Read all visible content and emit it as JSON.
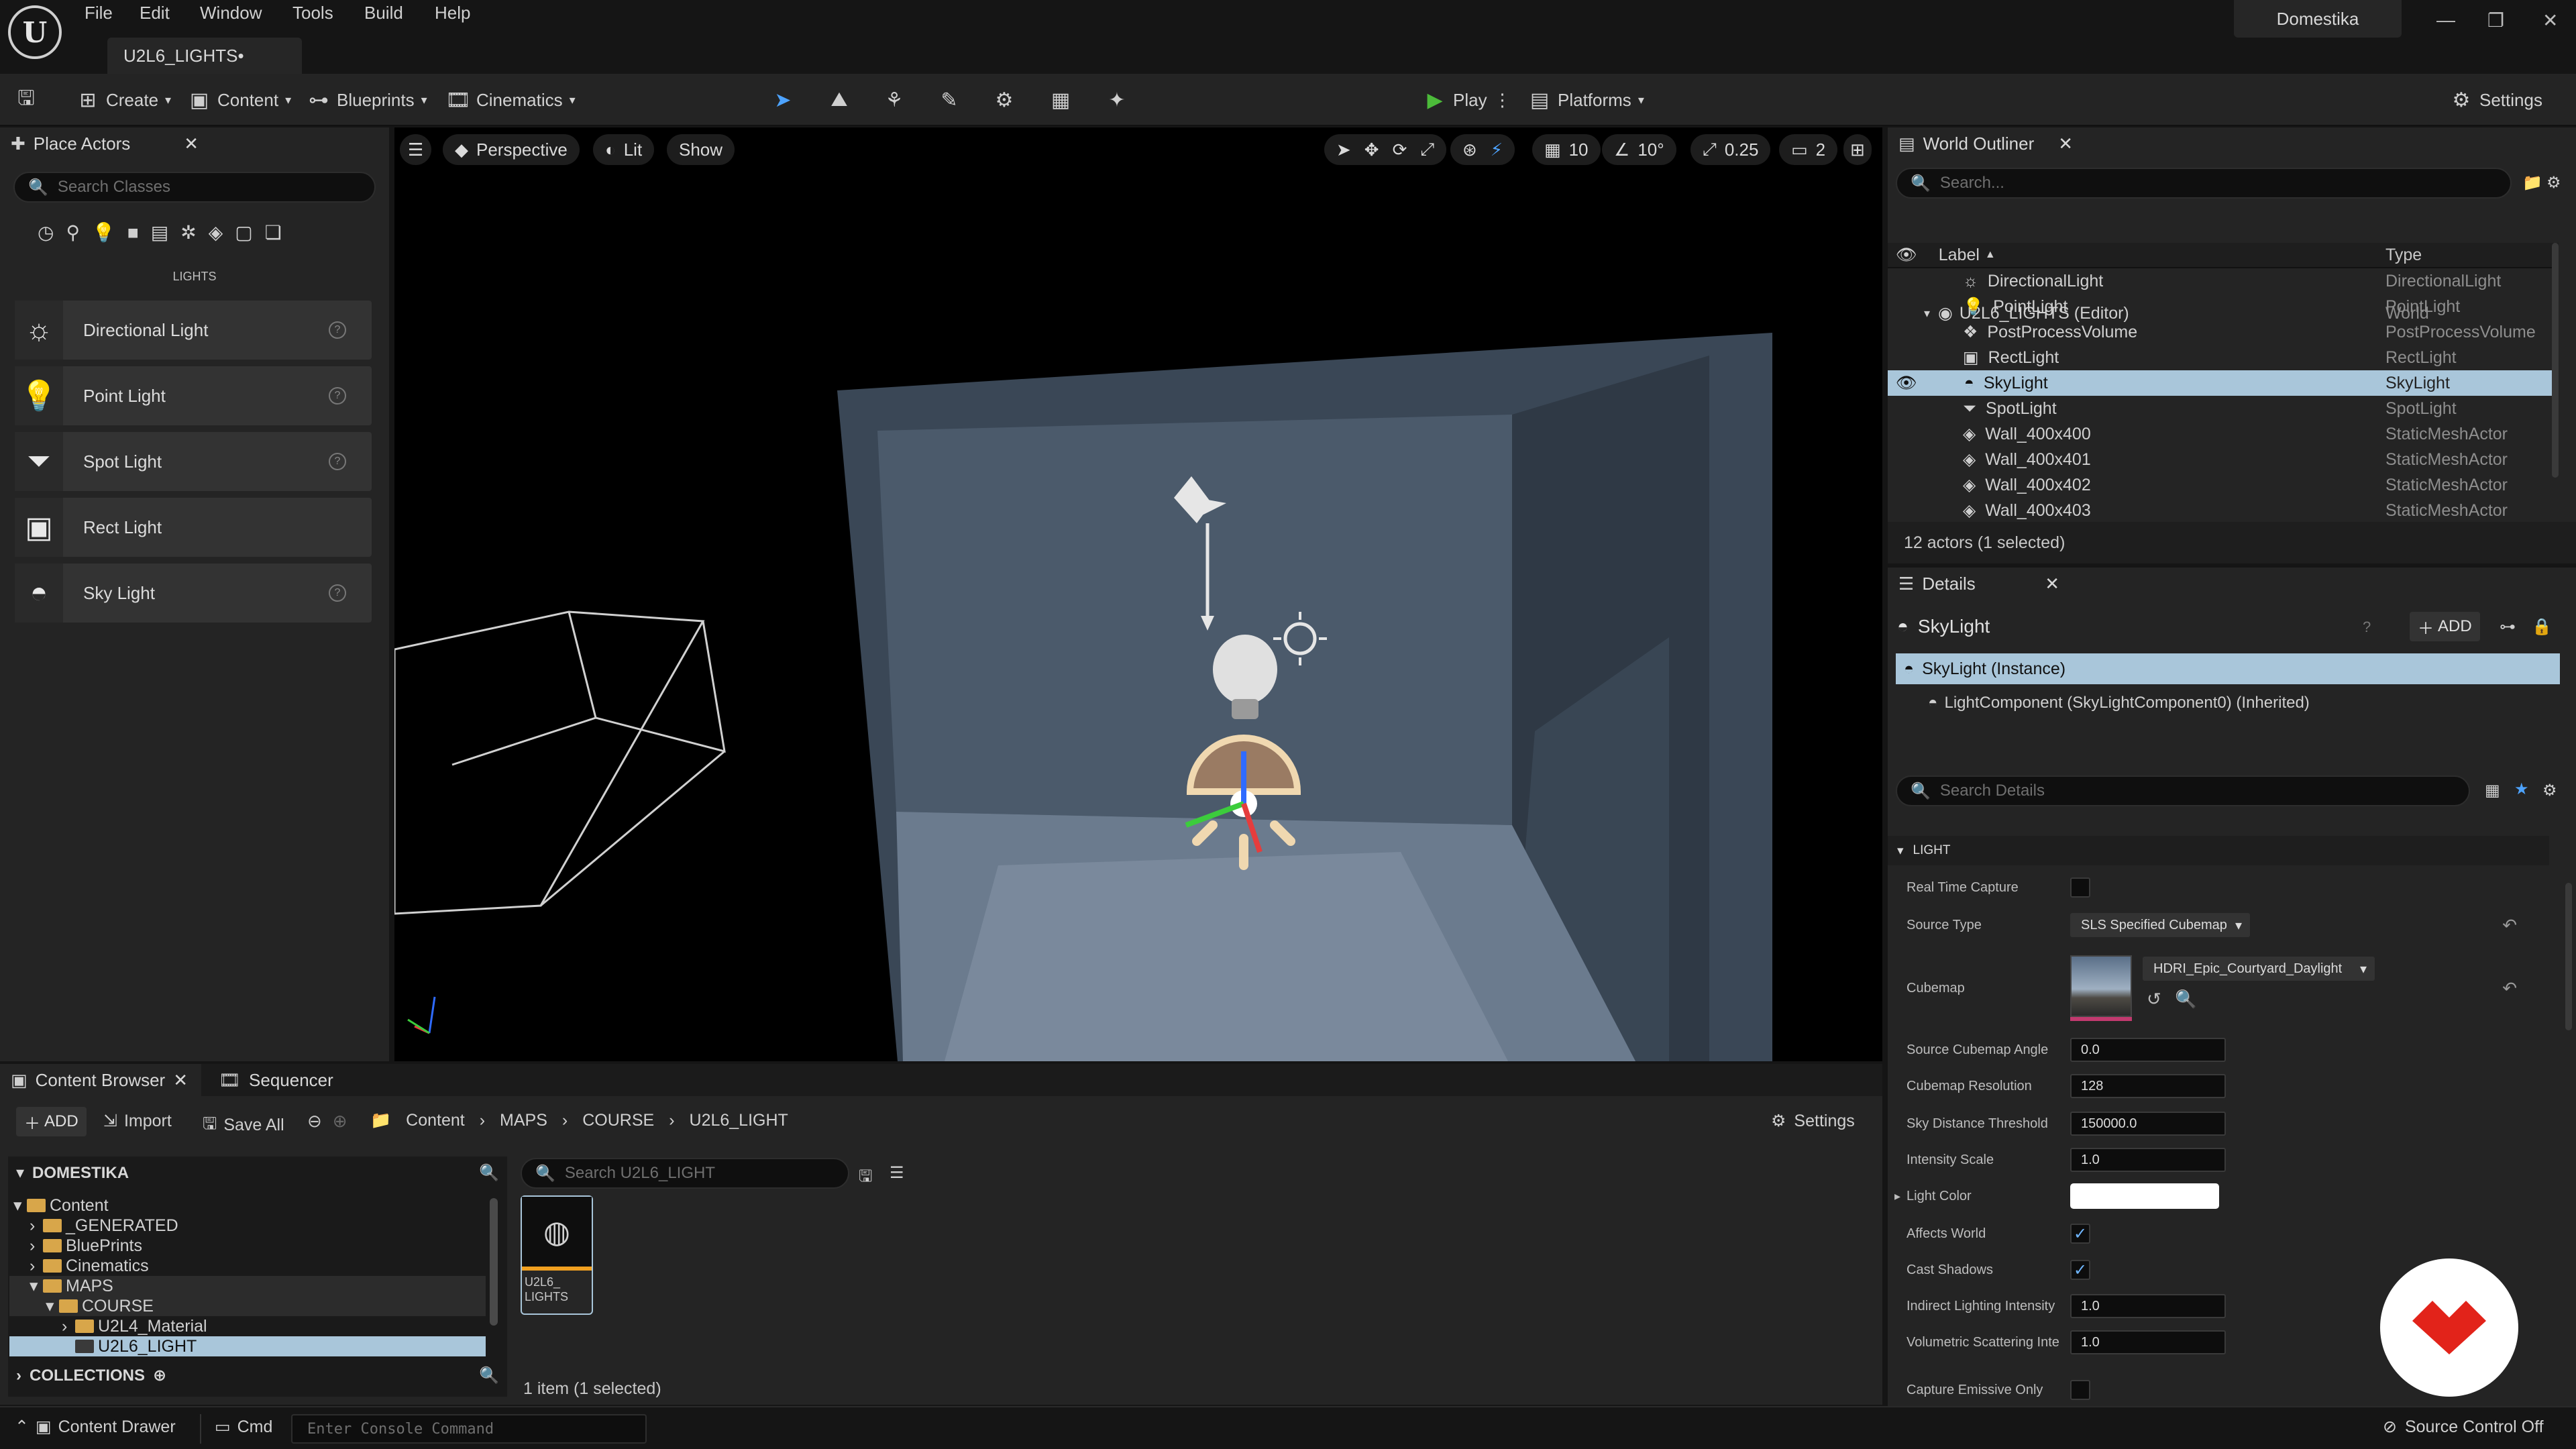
{
  "title_bar": {
    "menu": [
      "File",
      "Edit",
      "Window",
      "Tools",
      "Build",
      "Help"
    ],
    "map_tab": "U2L6_LIGHTS•",
    "brand": "Domestika"
  },
  "toolbar": {
    "create": "Create",
    "content": "Content",
    "blueprints": "Blueprints",
    "cinematics": "Cinematics",
    "play": "Play",
    "platforms": "Platforms",
    "settings": "Settings"
  },
  "place_actors": {
    "tab": "Place Actors",
    "search_placeholder": "Search Classes",
    "category": "LIGHTS",
    "items": [
      "Directional Light",
      "Point Light",
      "Spot Light",
      "Rect Light",
      "Sky Light"
    ]
  },
  "viewport": {
    "perspective": "Perspective",
    "lit": "Lit",
    "show": "Show",
    "grid_snap": "10",
    "rotation_snap": "10°",
    "scale_snap": "0.25",
    "camera_speed": "2"
  },
  "world_outliner": {
    "tab": "World Outliner",
    "search_placeholder": "Search...",
    "col_label": "Label",
    "col_type": "Type",
    "root": {
      "label": "U2L6_LIGHTS (Editor)",
      "type": "World"
    },
    "rows": [
      {
        "label": "DirectionalLight",
        "type": "DirectionalLight"
      },
      {
        "label": "PointLight",
        "type": "PointLight"
      },
      {
        "label": "PostProcessVolume",
        "type": "PostProcessVolume"
      },
      {
        "label": "RectLight",
        "type": "RectLight"
      },
      {
        "label": "SkyLight",
        "type": "SkyLight"
      },
      {
        "label": "SpotLight",
        "type": "SpotLight"
      },
      {
        "label": "Wall_400x400",
        "type": "StaticMeshActor"
      },
      {
        "label": "Wall_400x401",
        "type": "StaticMeshActor"
      },
      {
        "label": "Wall_400x402",
        "type": "StaticMeshActor"
      },
      {
        "label": "Wall_400x403",
        "type": "StaticMeshActor"
      }
    ],
    "footer": "12 actors (1 selected)"
  },
  "details": {
    "tab": "Details",
    "actor": "SkyLight",
    "add": "ADD",
    "instance": "SkyLight (Instance)",
    "component": "LightComponent (SkyLightComponent0) (Inherited)",
    "search_placeholder": "Search Details",
    "section": "LIGHT",
    "real_time_capture": "Real Time Capture",
    "source_type_label": "Source Type",
    "source_type_value": "SLS Specified Cubemap",
    "cubemap_label": "Cubemap",
    "cubemap_value": "HDRI_Epic_Courtyard_Daylight",
    "props": [
      {
        "label": "Source Cubemap Angle",
        "value": "0.0"
      },
      {
        "label": "Cubemap Resolution",
        "value": "128"
      },
      {
        "label": "Sky Distance Threshold",
        "value": "150000.0"
      },
      {
        "label": "Intensity Scale",
        "value": "1.0"
      }
    ],
    "light_color": "Light Color",
    "affects_world": "Affects World",
    "cast_shadows": "Cast Shadows",
    "props2": [
      {
        "label": "Indirect Lighting Intensity",
        "value": "1.0"
      },
      {
        "label": "Volumetric Scattering Inte",
        "value": "1.0"
      }
    ],
    "capture_emissive": "Capture Emissive Only"
  },
  "content_browser": {
    "tab": "Content Browser",
    "sequencer_tab": "Sequencer",
    "add": "ADD",
    "import": "Import",
    "save_all": "Save All",
    "breadcrumb": [
      "Content",
      "MAPS",
      "COURSE",
      "U2L6_LIGHT"
    ],
    "settings": "Settings",
    "tree_root": "DOMESTIKA",
    "tree": [
      {
        "label": "Content",
        "depth": 0,
        "open": true
      },
      {
        "label": "_GENERATED",
        "depth": 1
      },
      {
        "label": "BluePrints",
        "depth": 1
      },
      {
        "label": "Cinematics",
        "depth": 1
      },
      {
        "label": "MAPS",
        "depth": 1,
        "open": true
      },
      {
        "label": "COURSE",
        "depth": 2,
        "open": true
      },
      {
        "label": "U2L4_Material",
        "depth": 3
      },
      {
        "label": "U2L6_LIGHT",
        "depth": 3,
        "selected": true
      }
    ],
    "collections": "COLLECTIONS",
    "search_placeholder": "Search U2L6_LIGHT",
    "asset_label": "U2L6_\nLIGHTS",
    "footer": "1 item (1 selected)"
  },
  "status_bar": {
    "content_drawer": "Content Drawer",
    "cmd": "Cmd",
    "console_placeholder": "Enter Console Command",
    "source_control": "Source Control Off"
  },
  "colors": {
    "accent": "#a9c6da",
    "play_green": "#4cbb3a",
    "domestika_red": "#e2231a"
  }
}
